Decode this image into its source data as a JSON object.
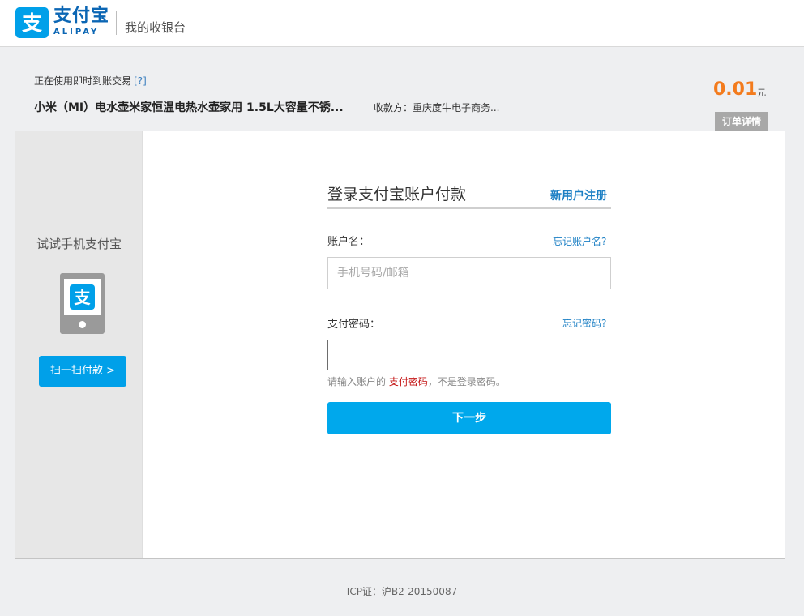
{
  "header": {
    "logo_glyph": "支",
    "brand_cn": "支付宝",
    "brand_en": "ALIPAY",
    "title": "我的收银台"
  },
  "order": {
    "type_text": "正在使用即时到账交易",
    "help_link": "[?]",
    "item_name": "小米（MI）电水壶米家恒温电热水壶家用 1.5L大容量不锈...",
    "payee": "收款方：重庆度牛电子商务...",
    "amount": "0.01",
    "amount_unit": "元",
    "detail_tab": "订单详情"
  },
  "sidebar": {
    "title": "试试手机支付宝",
    "scan_button": "扫一扫付款 >"
  },
  "login": {
    "title": "登录支付宝账户付款",
    "register_link": "新用户注册",
    "account_label": "账户名：",
    "forgot_account": "忘记账户名?",
    "account_placeholder": "手机号码/邮箱",
    "account_value": "",
    "password_label": "支付密码：",
    "forgot_password": "忘记密码?",
    "password_value": "",
    "hint_prefix": "请输入账户的 ",
    "hint_strong": "支付密码",
    "hint_suffix": "，不是登录密码。",
    "submit_button": "下一步"
  },
  "footer": {
    "icp": "ICP证：沪B2-20150087"
  },
  "colors": {
    "brand_blue": "#00a0e9",
    "link_blue": "#1b7fc4",
    "amount_orange": "#f37b1d",
    "hint_red": "#c41515"
  },
  "icons": [
    "alipay-logo-icon",
    "alipay-app-icon"
  ]
}
